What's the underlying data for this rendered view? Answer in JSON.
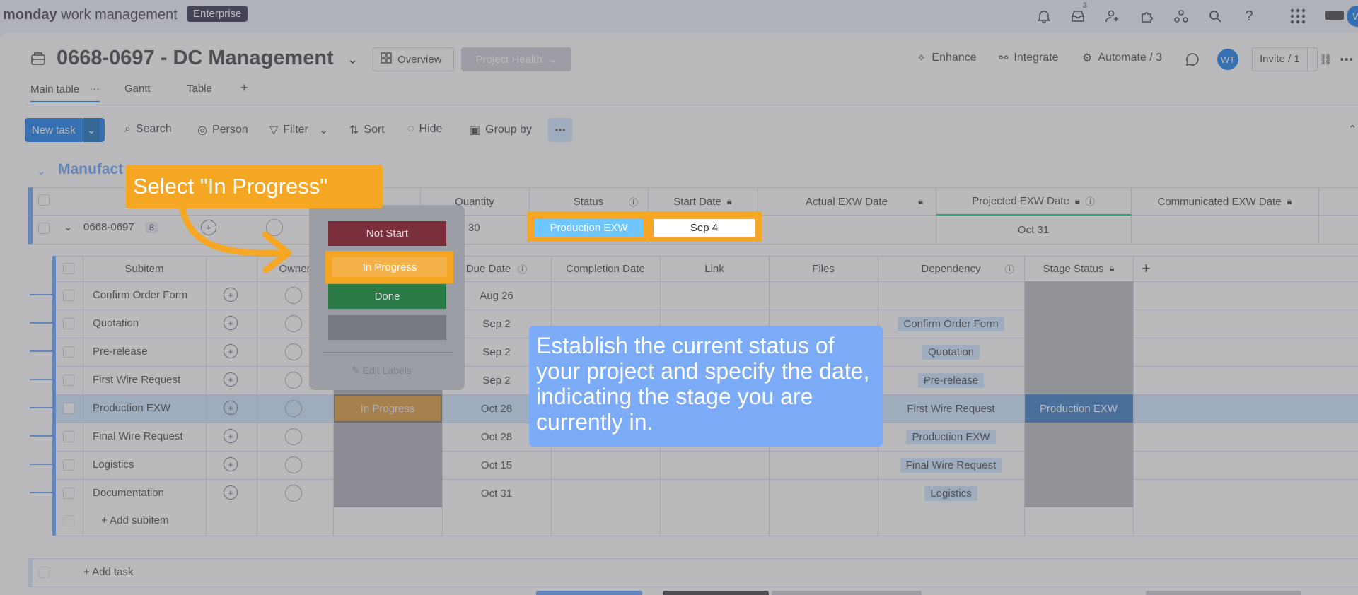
{
  "topbar": {
    "brand_bold": "monday",
    "brand_rest": " work management",
    "plan_badge": "Enterprise",
    "inbox_count": "3",
    "avatar_initials": "W"
  },
  "board": {
    "title": "0668-0697 - DC Management",
    "overview_label": "Overview",
    "project_health_label": "Project Health",
    "actions": {
      "enhance": "Enhance",
      "integrate": "Integrate",
      "automate": "Automate / 3",
      "user_initials": "WT",
      "invite": "Invite / 1"
    },
    "tabs": [
      "Main table",
      "Gantt",
      "Table"
    ],
    "toolbar": {
      "new_task": "New task",
      "search": "Search",
      "person": "Person",
      "filter": "Filter",
      "sort": "Sort",
      "hide": "Hide",
      "group_by": "Group by"
    },
    "group_name": "Manufact",
    "columns": [
      "Quantity",
      "Status",
      "Start Date",
      "Actual EXW Date",
      "Projected EXW Date",
      "Communicated EXW Date"
    ],
    "parent_row": {
      "name": "0668-0697",
      "subitem_count": "8",
      "quantity": "30",
      "status": "Production EXW",
      "start_date": "Sep 4",
      "projected_exw": "Oct 31"
    },
    "sub_columns": [
      "Subitem",
      "Owner",
      "Due Date",
      "Completion Date",
      "Link",
      "Files",
      "Dependency",
      "Stage Status"
    ],
    "subitems": [
      {
        "name": "Confirm Order Form",
        "due": "Aug 26",
        "dependency": "",
        "stage": ""
      },
      {
        "name": "Quotation",
        "due": "Sep 2",
        "dependency": "Confirm Order Form",
        "stage": ""
      },
      {
        "name": "Pre-release",
        "due": "Sep 2",
        "dependency": "Quotation",
        "stage": ""
      },
      {
        "name": "First Wire Request",
        "due": "Sep 2",
        "dependency": "Pre-release",
        "stage": ""
      },
      {
        "name": "Production EXW",
        "due": "Oct 28",
        "dependency": "First Wire Request",
        "stage": "Production EXW",
        "status": "In Progress"
      },
      {
        "name": "Final Wire Request",
        "due": "Oct 28",
        "dependency": "Production EXW",
        "stage": ""
      },
      {
        "name": "Logistics",
        "due": "Oct 15",
        "dependency": "Final Wire Request",
        "stage": ""
      },
      {
        "name": "Documentation",
        "due": "Oct 31",
        "dependency": "Logistics",
        "stage": ""
      }
    ],
    "add_subitem": "+ Add subitem",
    "add_task": "+ Add task"
  },
  "status_menu": {
    "options": [
      "Not Start",
      "In Progress",
      "Done",
      ""
    ],
    "edit_labels": "Edit Labels"
  },
  "guide": {
    "callout": "Select \"In Progress\"",
    "tooltip": "Establish the current status of your project and specify the date, indicating the stage you are currently in."
  },
  "colors": {
    "primary": "#0073ea",
    "highlight": "#f5a623",
    "not_start": "#bb3354",
    "in_progress": "#fdab3d",
    "done": "#00c875",
    "production_exw": "#579bfc",
    "tooltip_bg": "#6ea5ff"
  }
}
